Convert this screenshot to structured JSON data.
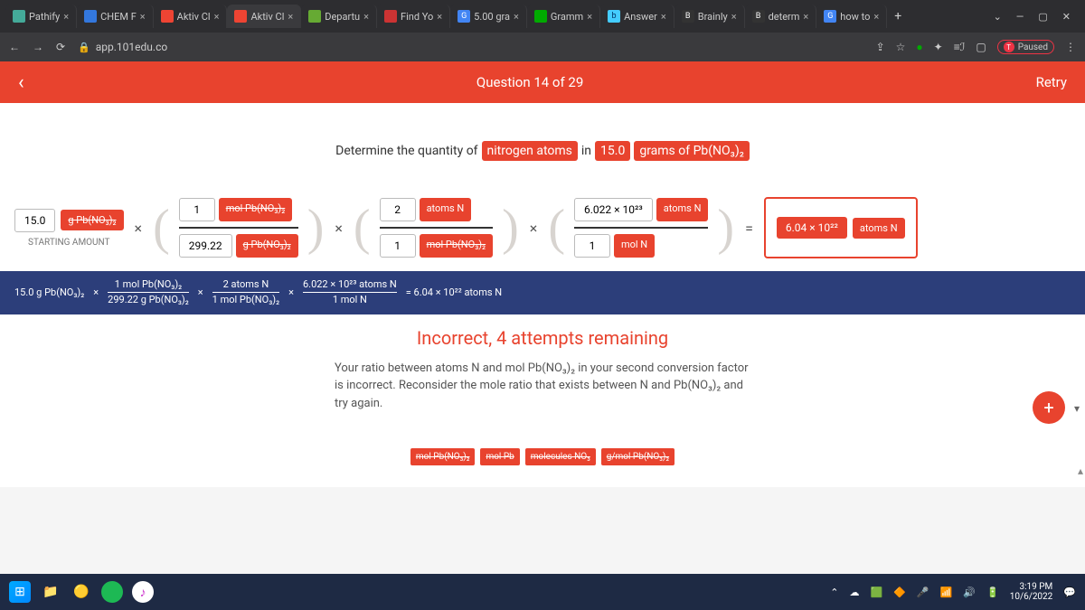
{
  "browser": {
    "tabs": [
      {
        "label": "Pathify"
      },
      {
        "label": "CHEM F"
      },
      {
        "label": "Aktiv Cl"
      },
      {
        "label": "Aktiv Cl"
      },
      {
        "label": "Departu"
      },
      {
        "label": "Find Yo"
      },
      {
        "label": "5.00 gra"
      },
      {
        "label": "Gramm"
      },
      {
        "label": "Answer"
      },
      {
        "label": "Brainly"
      },
      {
        "label": "determ"
      },
      {
        "label": "how to"
      }
    ],
    "url": "app.101edu.co",
    "paused": "Paused"
  },
  "header": {
    "question": "Question 14 of 29",
    "retry": "Retry"
  },
  "prompt": {
    "p1": "Determine the quantity of",
    "chip1": "nitrogen atoms",
    "p2": "in",
    "chip2": "15.0",
    "p3": "grams of Pb(NO₃)₂"
  },
  "start": {
    "value": "15.0",
    "unit": "g Pb(NO₃)₂",
    "label": "STARTING AMOUNT"
  },
  "f1": {
    "num_v": "1",
    "num_u": "mol Pb(NO₃)₂",
    "den_v": "299.22",
    "den_u": "g Pb(NO₃)₂"
  },
  "f2": {
    "num_v": "2",
    "num_u": "atoms N",
    "den_v": "1",
    "den_u": "mol Pb(NO₃)₂"
  },
  "f3": {
    "num_v": "6.022 × 10²³",
    "num_u": "atoms N",
    "den_v": "1",
    "den_u": "mol N"
  },
  "answer": {
    "value": "6.04 × 10²²",
    "unit": "atoms N"
  },
  "eq": {
    "lead": "15.0 g Pb(NO₃)₂",
    "f1n": "1 mol Pb(NO₃)₂",
    "f1d": "299.22 g Pb(NO₃)₂",
    "f2n": "2 atoms N",
    "f2d": "1 mol Pb(NO₃)₂",
    "f3n": "6.022 × 10²³ atoms N",
    "f3d": "1 mol N",
    "result": "= 6.04 × 10²² atoms N"
  },
  "feedback": {
    "title": "Incorrect, 4 attempts remaining",
    "text": "Your ratio between atoms N and mol Pb(NO₃)₂ in your second conversion factor is incorrect. Reconsider the mole ratio that exists between N and Pb(NO₃)₂ and try again."
  },
  "tiles": {
    "a": "mol Pb(NO₃)₂",
    "b": "mol Pb",
    "c": "molecules NO₃",
    "d": "g/mol Pb(NO₃)₂"
  },
  "ops": {
    "times": "×",
    "eq": "="
  },
  "clock": {
    "time": "3:19 PM",
    "date": "10/6/2022"
  }
}
